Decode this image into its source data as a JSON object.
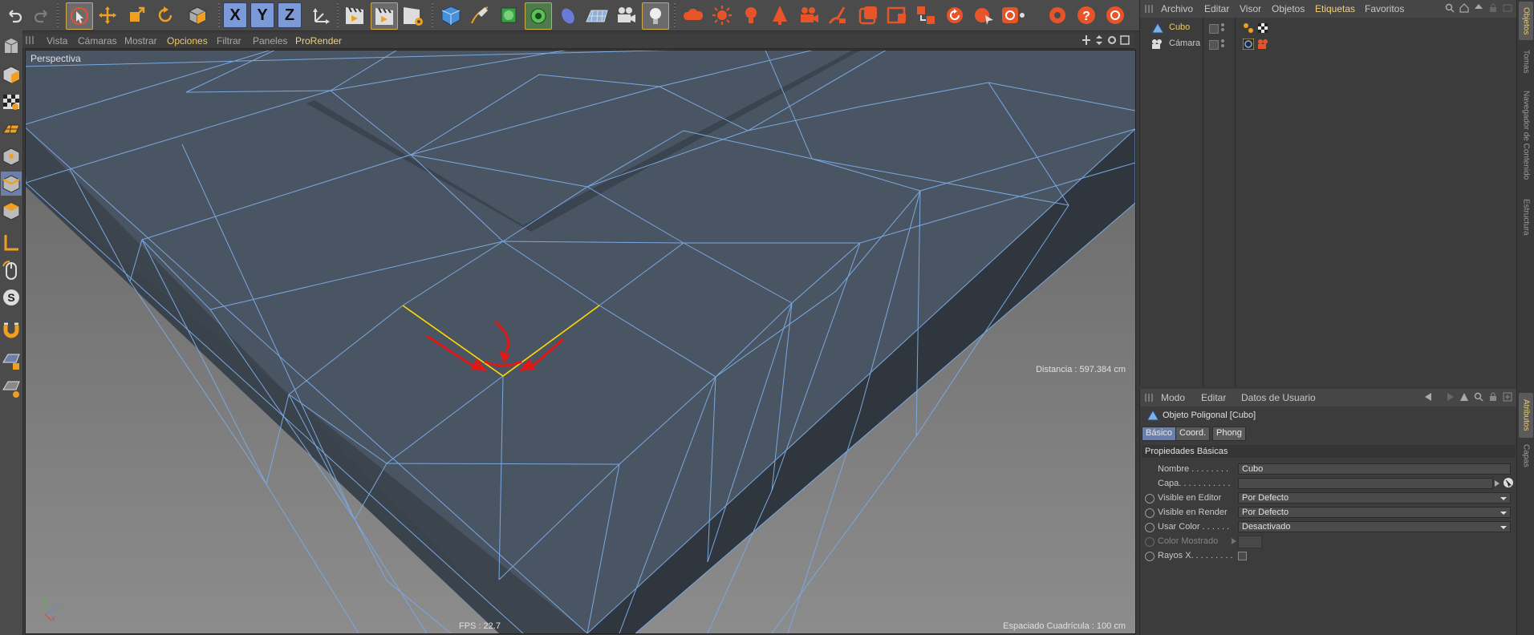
{
  "viewport": {
    "menu": [
      "Vista",
      "Cámaras",
      "Mostrar",
      "Opciones",
      "Filtrar",
      "Paneles",
      "ProRender"
    ],
    "active_menu": "Opciones",
    "label": "Perspectiva",
    "distance": "Distancia : 597.384 cm",
    "fps": "FPS : 22.7",
    "grid_spacing": "Espaciado Cuadrícula : 100 cm",
    "axis_x": "x",
    "axis_y": "y",
    "axis_z": "z"
  },
  "toolbar": {
    "axis_buttons": [
      "X",
      "Y",
      "Z"
    ]
  },
  "object_manager": {
    "menu": [
      "Archivo",
      "Editar",
      "Visor",
      "Objetos",
      "Etiquetas",
      "Favoritos"
    ],
    "active_menu": "Etiquetas",
    "objects": [
      {
        "name": "Cubo",
        "selected": true
      },
      {
        "name": "Cámara",
        "selected": false
      }
    ]
  },
  "attribute_manager": {
    "menu": [
      "Modo",
      "Editar",
      "Datos de Usuario"
    ],
    "object_title": "Objeto Poligonal [Cubo]",
    "tabs": [
      "Básico",
      "Coord.",
      "Phong"
    ],
    "active_tab": "Básico",
    "section": "Propiedades Básicas",
    "fields": {
      "nombre_label": "Nombre . . . . . . . .",
      "nombre_value": "Cubo",
      "capa_label": "Capa. . . . . . . . . . .",
      "capa_value": "",
      "visible_editor_label": "Visible en Editor",
      "visible_editor_value": "Por Defecto",
      "visible_render_label": "Visible en Render",
      "visible_render_value": "Por Defecto",
      "usar_color_label": "Usar Color . . . . . .",
      "usar_color_value": "Desactivado",
      "color_mostrado_label": "Color Mostrado",
      "rayos_x_label": "Rayos X. . . . . . . . ."
    }
  },
  "side_tabs": [
    "Objetos",
    "Tomas",
    "Navegador de Contenido",
    "Estructura",
    "Atributos",
    "Capas"
  ],
  "colors": {
    "accent": "#f0c864",
    "edge_selected": "#ffd800",
    "annotation": "#e01818",
    "wireframe": "#7aa8e0",
    "mesh_face": "#4a5563",
    "floor": "#7a7a7a"
  }
}
